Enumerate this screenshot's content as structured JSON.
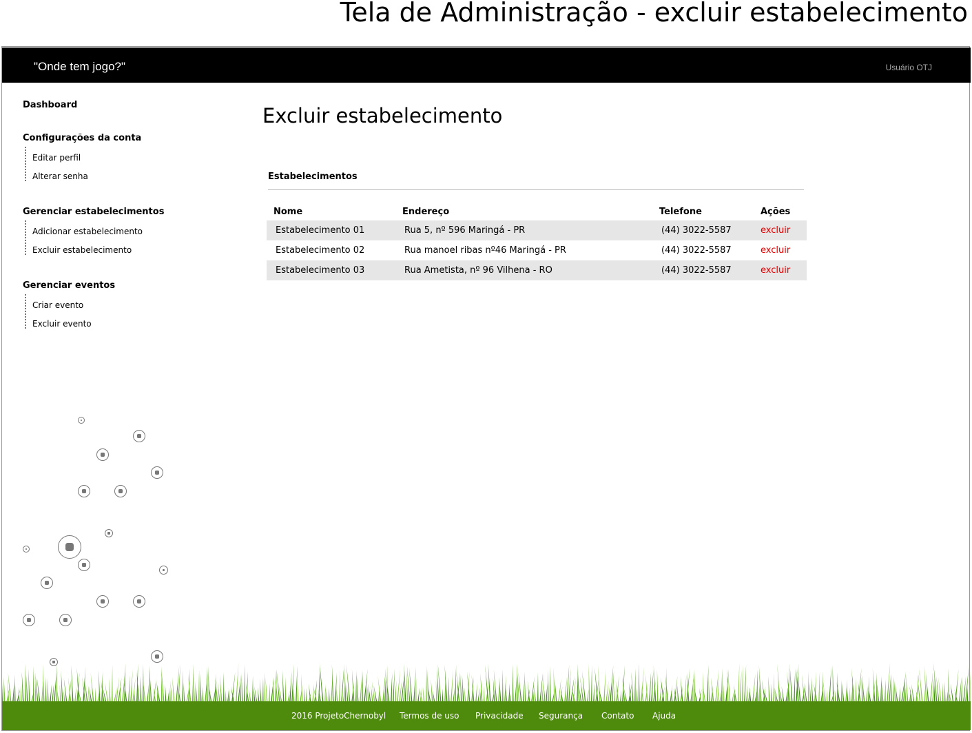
{
  "page_title": "Tela de Administração - excluir estabelecimento",
  "header": {
    "brand": "\"Onde tem jogo?\"",
    "user": "Usuário OTJ"
  },
  "sidebar": {
    "dashboard": "Dashboard",
    "account": {
      "title": "Configurações da conta",
      "items": [
        "Editar perfil",
        "Alterar senha"
      ]
    },
    "establishments": {
      "title": "Gerenciar estabelecimentos",
      "items": [
        "Adicionar estabelecimento",
        "Excluir estabelecimento"
      ]
    },
    "events": {
      "title": "Gerenciar eventos",
      "items": [
        "Criar evento",
        "Excluir evento"
      ]
    }
  },
  "main": {
    "heading": "Excluir estabelecimento",
    "section_title": "Estabelecimentos",
    "columns": [
      "Nome",
      "Endereço",
      "Telefone",
      "Ações"
    ],
    "rows": [
      {
        "name": "Estabelecimento 01",
        "address": "Rua 5, nº 596 Maringá - PR",
        "phone": "(44) 3022-5587",
        "action": "excluir"
      },
      {
        "name": "Estabelecimento 02",
        "address": "Rua manoel ribas nº46 Maringá - PR",
        "phone": "(44) 3022-5587",
        "action": "excluir"
      },
      {
        "name": "Estabelecimento 03",
        "address": "Rua Ametista, nº 96 Vilhena - RO",
        "phone": "(44) 3022-5587",
        "action": "excluir"
      }
    ]
  },
  "footer": {
    "links": [
      "2016 ProjetoChernobyl",
      "Termos de uso",
      "Privacidade",
      "Segurança",
      "Contato",
      "Ajuda"
    ]
  },
  "colors": {
    "topbar": "#000000",
    "action": "#e00000",
    "footer": "#4e8a0c",
    "grass": "#5aa51e",
    "row_shade": "#e6e6e6"
  },
  "icons": {
    "decoration": "soccer-ball-icon"
  }
}
